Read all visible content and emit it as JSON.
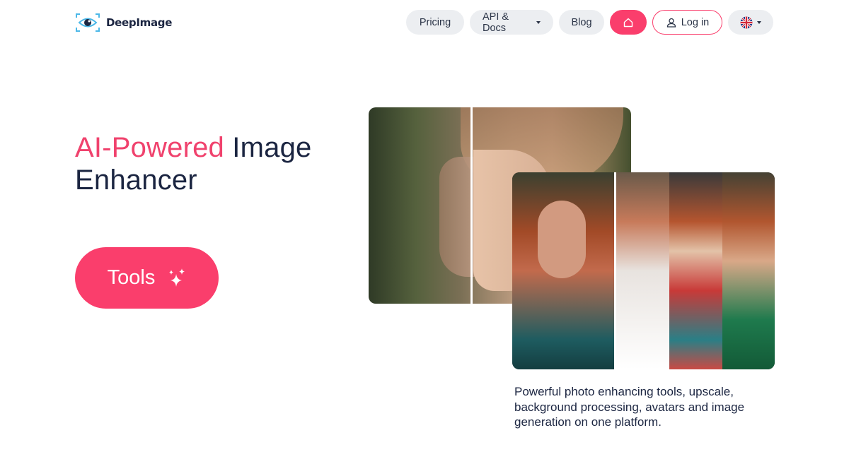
{
  "brand": {
    "name": "DeepImage",
    "accent_color": "#fa3e6c",
    "logo_icon": "eye-icon"
  },
  "nav": {
    "pricing": "Pricing",
    "api_docs": "API & Docs",
    "blog": "Blog",
    "home_icon": "home-icon",
    "login": "Log in",
    "login_icon": "user-icon",
    "language_icon": "uk-flag-icon"
  },
  "hero": {
    "headline_accent": "AI-Powered",
    "headline_rest_1": " Image",
    "headline_rest_2": "Enhancer",
    "tools_button": "Tools",
    "tools_icon": "sparkles-icon",
    "description": "Powerful photo enhancing tools, upscale, background processing, avatars and image generation on one platform."
  }
}
